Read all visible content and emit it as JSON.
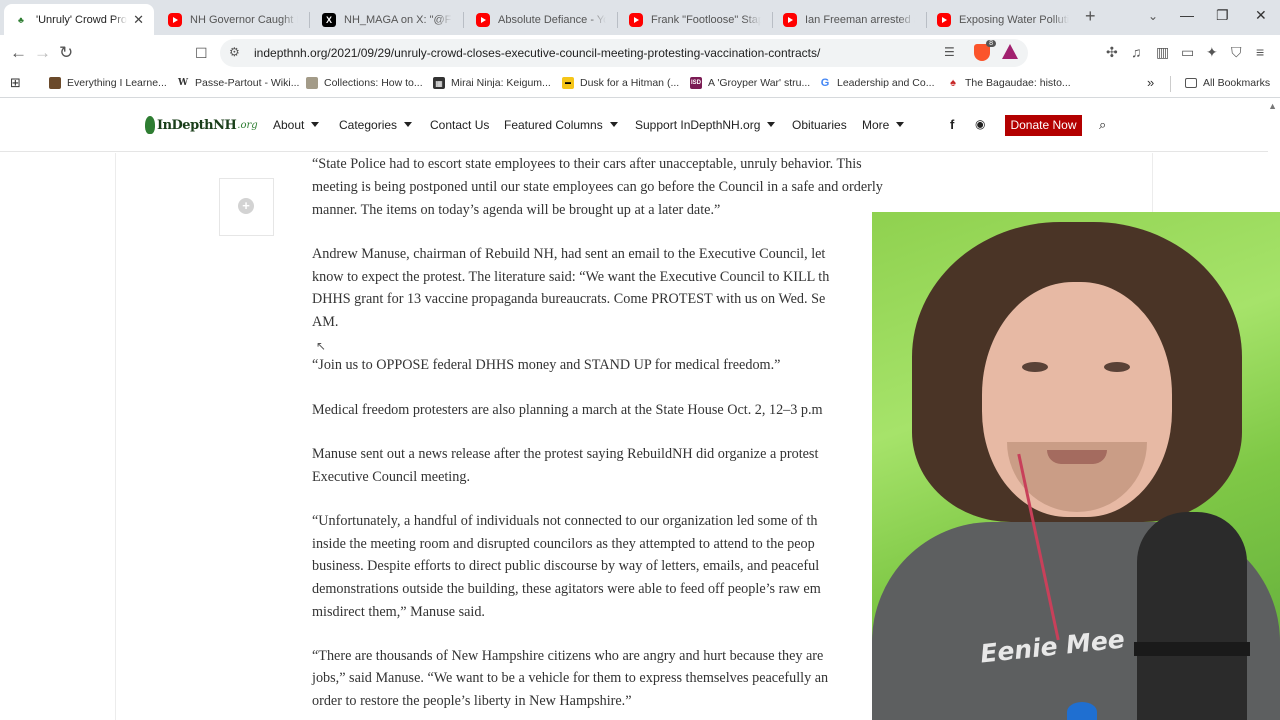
{
  "browser": {
    "tabs": [
      {
        "title": "'Unruly' Crowd Protests Vaccination Contracts",
        "favicon": "leaf-icon",
        "active": true
      },
      {
        "title": "NH Governor Caught In The",
        "favicon": "youtube-icon"
      },
      {
        "title": "NH_MAGA on X: \"@Frank",
        "favicon": "x-icon"
      },
      {
        "title": "Absolute Defiance - YouTube",
        "favicon": "youtube-icon"
      },
      {
        "title": "Frank \"Footloose\" Staples",
        "favicon": "youtube-icon"
      },
      {
        "title": "Ian Freeman arrested and",
        "favicon": "youtube-icon"
      },
      {
        "title": "Exposing Water Pollution",
        "favicon": "youtube-icon"
      }
    ],
    "new_tab": "+",
    "url": "indepthnh.org/2021/09/29/unruly-crowd-closes-executive-council-meeting-protesting-vaccination-contracts/",
    "shield_count": "8",
    "bookmarks": [
      {
        "label": "Everything I Learne...",
        "icon": "bookmark-image-icon"
      },
      {
        "label": "Passe-Partout - Wiki...",
        "icon": "wikipedia-icon"
      },
      {
        "label": "Collections: How to...",
        "icon": "bookmark-image-icon"
      },
      {
        "label": "Mirai Ninja: Keigum...",
        "icon": "bookmark-image-icon"
      },
      {
        "label": "Dusk for a Hitman (...",
        "icon": "imdb-icon"
      },
      {
        "label": "A 'Groyper War' stru...",
        "icon": "isd-icon"
      },
      {
        "label": "Leadership and Co...",
        "icon": "google-icon"
      },
      {
        "label": "The Bagaudae: histo...",
        "icon": "bookmark-image-icon"
      }
    ],
    "all_bookmarks": "All Bookmarks",
    "more_bookmarks": "»"
  },
  "site": {
    "logo_text": "InDepthNH",
    "logo_suffix": ".org",
    "nav": [
      {
        "label": "About",
        "dropdown": true
      },
      {
        "label": "Categories",
        "dropdown": true
      },
      {
        "label": "Contact Us",
        "dropdown": false
      },
      {
        "label": "Featured Columns",
        "dropdown": true
      },
      {
        "label": "Support InDepthNH.org",
        "dropdown": true
      },
      {
        "label": "Obituaries",
        "dropdown": false
      },
      {
        "label": "More",
        "dropdown": true
      }
    ],
    "social": {
      "facebook": "f",
      "rss": "RSS"
    },
    "donate_label": "Donate Now",
    "share_icon": "+"
  },
  "article": {
    "lines": [
      "“State Police had to escort state employees to their cars after unacceptable, unruly behavior. This",
      "meeting is being postponed until our state employees can go before the Council in a safe and orderly",
      "manner. The items on today’s agenda will be brought up at a later date.”",
      "Andrew Manuse, chairman of Rebuild NH, had sent an email to the Executive Council, let",
      "know to expect the protest. The literature said: “We want the Executive Council to KILL th",
      "DHHS grant for 13 vaccine propaganda bureaucrats. Come PROTEST with us on Wed. Se",
      "AM.",
      "“Join us to OPPOSE federal DHHS money and STAND UP for medical freedom.”",
      "Medical freedom protesters are also planning a march at the State House Oct. 2, 12–3 p.m",
      "Manuse sent out a news release after the protest saying RebuildNH did organize a protest",
      "Executive Council meeting.",
      "“Unfortunately, a handful of individuals not connected to our organization led some of th",
      "inside the meeting room and disrupted councilors as they attempted to attend to the peop",
      "business. Despite efforts to direct public discourse by way of letters, emails, and peaceful",
      "demonstrations outside the building, these agitators were able to feed off people’s raw em",
      "misdirect them,” Manuse said.",
      "“There are thousands of New Hampshire citizens who are angry and hurt because they are",
      "jobs,” said Manuse. “We want to be a vehicle for them to express themselves peacefully an",
      "order to restore the people’s liberty in New Hampshire.”"
    ]
  },
  "webcam": {
    "shirt_text": "Eenie Mee"
  }
}
